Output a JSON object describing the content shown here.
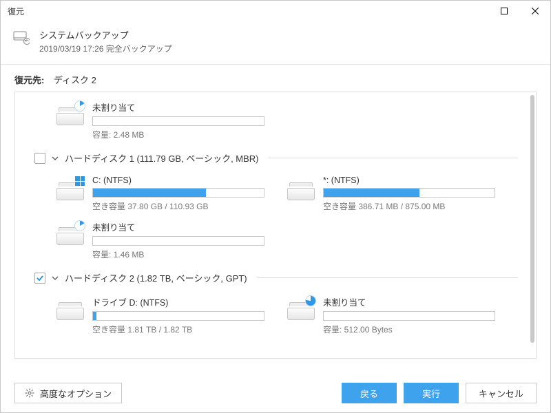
{
  "window": {
    "title": "復元"
  },
  "header": {
    "title": "システムバックアップ",
    "subtitle": "2019/03/19 17:26 完全バックアップ"
  },
  "destination": {
    "label": "復元先:",
    "value": "ディスク 2"
  },
  "parts": {
    "unalloc_top": {
      "title": "未割り当て",
      "capacity": "容量: 2.48 MB"
    },
    "disk1_header": "ハードディスク 1 (111.79 GB, ベーシック, MBR)",
    "c": {
      "title": "C: (NTFS)",
      "free": "空き容量 37.80 GB / 110.93 GB",
      "fill_pct": 66
    },
    "star": {
      "title": "*: (NTFS)",
      "free": "空き容量 386.71 MB / 875.00 MB",
      "fill_pct": 56
    },
    "unalloc_mid": {
      "title": "未割り当て",
      "capacity": "容量: 1.46 MB"
    },
    "disk2_header": "ハードディスク 2 (1.82 TB, ベーシック, GPT)",
    "d": {
      "title": "ドライブ D: (NTFS)",
      "free": "空き容量 1.81 TB / 1.82 TB",
      "fill_pct": 2
    },
    "unalloc_bot": {
      "title": "未割り当て",
      "capacity": "容量: 512.00 Bytes"
    }
  },
  "footer": {
    "options": "高度なオプション",
    "back": "戻る",
    "execute": "実行",
    "cancel": "キャンセル"
  }
}
